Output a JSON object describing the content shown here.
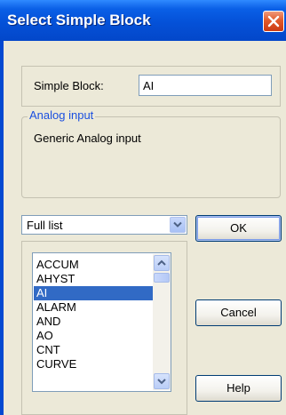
{
  "window": {
    "title": "Select Simple Block"
  },
  "simple_block": {
    "label": "Simple Block:",
    "value": "AI"
  },
  "group": {
    "title": "Analog input",
    "description": "Generic Analog input"
  },
  "filter": {
    "selected": "Full list"
  },
  "block_list": {
    "items": [
      "ACCUM",
      "AHYST",
      "AI",
      "ALARM",
      "AND",
      "AO",
      "CNT",
      "CURVE"
    ],
    "selected": "AI"
  },
  "buttons": {
    "ok": "OK",
    "cancel": "Cancel",
    "help": "Help"
  },
  "colors": {
    "title_bar": "#0451d8",
    "selection": "#316ac5",
    "group_title": "#1a4fe0",
    "close_button": "#e25a2a",
    "dialog_bg": "#ece9d8"
  },
  "icons": {
    "close": "close-icon",
    "dropdown": "chevron-down-icon",
    "scroll_up": "scroll-up-icon",
    "scroll_down": "scroll-down-icon"
  }
}
